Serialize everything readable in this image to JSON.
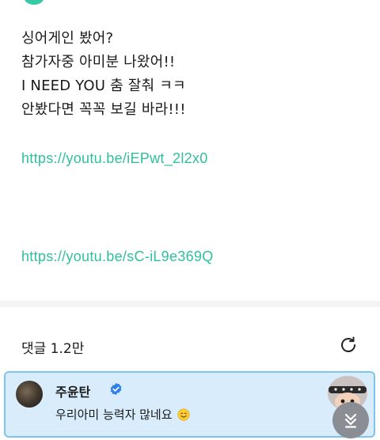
{
  "post": {
    "lines": [
      "싱어게인 봤어?",
      "참가자중 아미분 나왔어!!",
      " I NEED YOU 춤 잘춰 ㅋㅋ",
      "안봤다면 꼭꼭 보길 바라!!!"
    ],
    "links": [
      "https://youtu.be/iEPwt_2l2x0",
      "https://youtu.be/sC-iL9e369Q"
    ]
  },
  "comments": {
    "title": "댓글 1.2만",
    "items": [
      {
        "author": "주윤탄",
        "text": "우리아미 능력자 많네요",
        "verified": true
      }
    ]
  },
  "icons": {
    "refresh": "refresh-icon",
    "verified": "verified-badge-icon",
    "scroll_down": "scroll-to-bottom-icon",
    "emoji": "smiling-face-emoji"
  },
  "colors": {
    "link": "#2fbf9f",
    "highlight_bg": "#d8ecfb",
    "highlight_border": "#7fc4ec",
    "verified": "#2f80ed"
  }
}
